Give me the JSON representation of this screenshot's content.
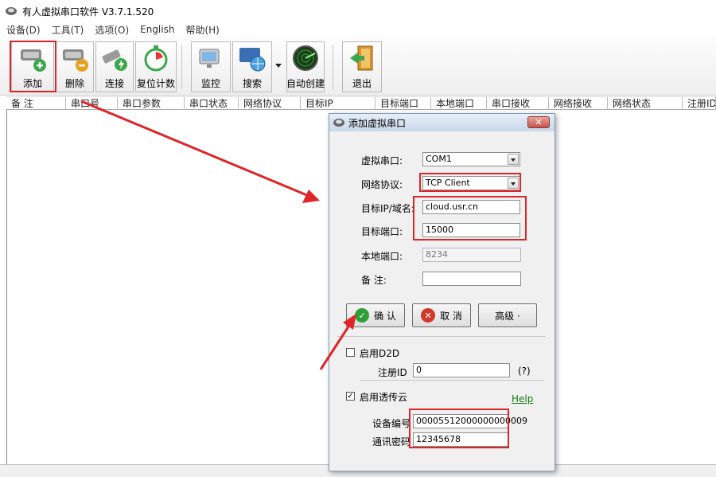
{
  "window": {
    "title": "有人虚拟串口软件 V3.7.1.520"
  },
  "menu": [
    "设备(D)",
    "工具(T)",
    "选项(O)",
    "English",
    "帮助(H)"
  ],
  "toolbar": {
    "add": "添加",
    "delete": "删除",
    "connect": "连接",
    "reset_count": "复位计数",
    "monitor": "监控",
    "search": "搜索",
    "auto_create": "自动创建",
    "exit": "退出"
  },
  "columns": [
    "备 注",
    "串口号",
    "串口参数",
    "串口状态",
    "网络协议",
    "目标IP",
    "目标端口",
    "本地端口",
    "串口接收",
    "网络接收",
    "网络状态",
    "注册ID"
  ],
  "dialog": {
    "title": "添加虚拟串口",
    "close": "✕",
    "virtual_port_label": "虚拟串口:",
    "virtual_port_value": "COM1",
    "protocol_label": "网络协议:",
    "protocol_value": "TCP Client",
    "target_ip_label": "目标IP/域名:",
    "target_ip_value": "cloud.usr.cn",
    "target_port_label": "目标端口:",
    "target_port_value": "15000",
    "local_port_label": "本地端口:",
    "local_port_value": "8234",
    "remark_label": "备  注:",
    "remark_value": "",
    "ok_label": "确 认",
    "cancel_label": "取 消",
    "advanced_label": "高级 ·",
    "enable_d2d_label": "启用D2D",
    "register_id_label": "注册ID",
    "register_id_value": "0",
    "register_id_help": "(?)",
    "enable_cloud_label": "启用透传云",
    "help_link": "Help",
    "device_id_label": "设备编号",
    "device_id_value": "00005512000000000009",
    "comm_password_label": "通讯密码",
    "comm_password_value": "12345678"
  },
  "colors": {
    "highlight": "#e0252a",
    "ok_green": "#2e9e36",
    "cancel_red": "#d03a2a"
  }
}
